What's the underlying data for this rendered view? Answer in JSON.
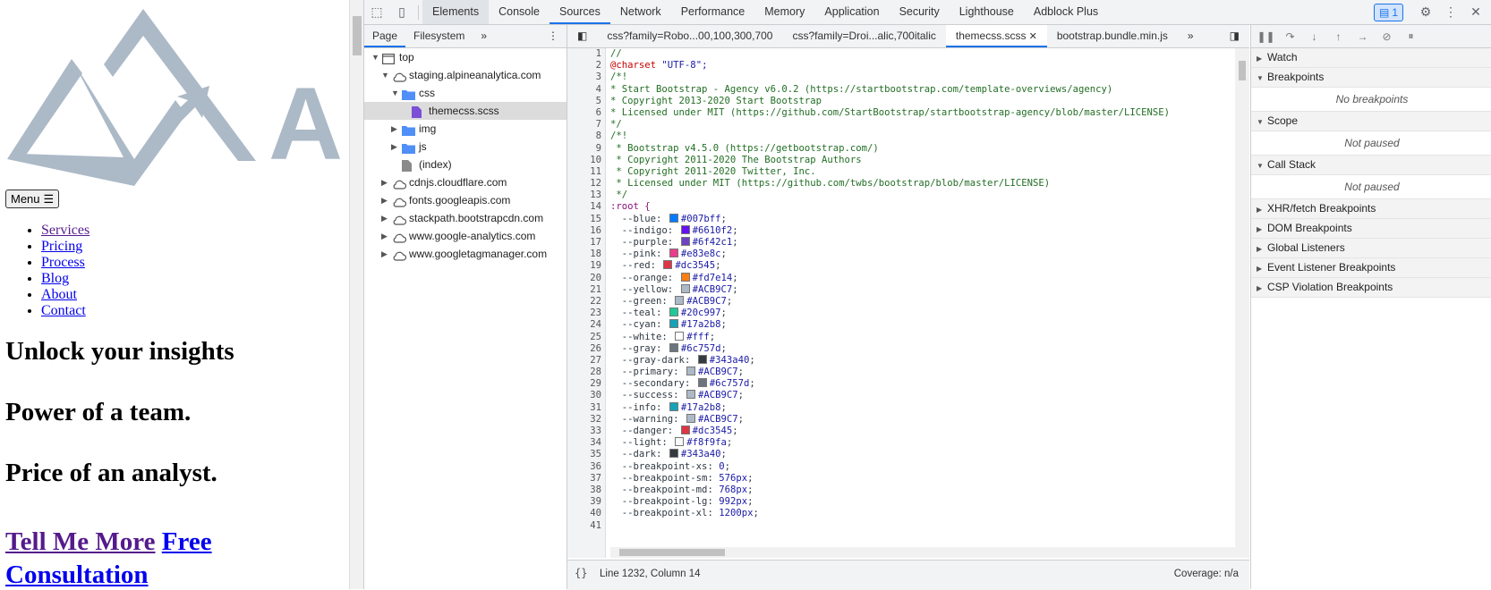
{
  "webpage": {
    "logo_letter": "A",
    "menu_label": "Menu",
    "nav": [
      "Services",
      "Pricing",
      "Process",
      "Blog",
      "About",
      "Contact"
    ],
    "headings": [
      "Unlock your insights",
      "Power of a team.",
      "Price of an analyst."
    ],
    "cta": {
      "tell_me_more": "Tell Me More",
      "free_consultation": "Free Consultation"
    }
  },
  "devtools": {
    "main_tabs": [
      "Elements",
      "Console",
      "Sources",
      "Network",
      "Performance",
      "Memory",
      "Application",
      "Security",
      "Lighthouse",
      "Adblock Plus"
    ],
    "issues_count": "1",
    "navigator": {
      "tabs": [
        "Page",
        "Filesystem"
      ],
      "tree": [
        {
          "label": "top",
          "level": 0,
          "type": "frame",
          "open": true
        },
        {
          "label": "staging.alpineanalytica.com",
          "level": 1,
          "type": "cloud",
          "open": true
        },
        {
          "label": "css",
          "level": 2,
          "type": "folder",
          "open": true
        },
        {
          "label": "themecss.scss",
          "level": 3,
          "type": "file-css",
          "selected": true
        },
        {
          "label": "img",
          "level": 2,
          "type": "folder",
          "open": false
        },
        {
          "label": "js",
          "level": 2,
          "type": "folder",
          "open": false
        },
        {
          "label": "(index)",
          "level": 2,
          "type": "file",
          "leaf": true
        },
        {
          "label": "cdnjs.cloudflare.com",
          "level": 1,
          "type": "cloud",
          "open": false
        },
        {
          "label": "fonts.googleapis.com",
          "level": 1,
          "type": "cloud",
          "open": false
        },
        {
          "label": "stackpath.bootstrapcdn.com",
          "level": 1,
          "type": "cloud",
          "open": false
        },
        {
          "label": "www.google-analytics.com",
          "level": 1,
          "type": "cloud",
          "open": false
        },
        {
          "label": "www.googletagmanager.com",
          "level": 1,
          "type": "cloud",
          "open": false
        }
      ]
    },
    "editor_tabs": [
      {
        "label": "css?family=Robo...00,100,300,700",
        "closable": false,
        "selected": false
      },
      {
        "label": "css?family=Droi...alic,700italic",
        "closable": false,
        "selected": false
      },
      {
        "label": "themecss.scss",
        "closable": true,
        "selected": true
      },
      {
        "label": "bootstrap.bundle.min.js",
        "closable": false,
        "selected": false
      }
    ],
    "code_lines": [
      {
        "t": "cm",
        "text": "//"
      },
      {
        "t": "charset",
        "at": "@charset",
        "val": "\"UTF-8\";"
      },
      {
        "t": "cm",
        "text": "/*!"
      },
      {
        "t": "cm",
        "text": "* Start Bootstrap - Agency v6.0.2 (https://startbootstrap.com/template-overviews/agency)"
      },
      {
        "t": "cm",
        "text": "* Copyright 2013-2020 Start Bootstrap"
      },
      {
        "t": "cm",
        "text": "* Licensed under MIT (https://github.com/StartBootstrap/startbootstrap-agency/blob/master/LICENSE)"
      },
      {
        "t": "cm",
        "text": "*/"
      },
      {
        "t": "cm",
        "text": "/*!"
      },
      {
        "t": "cm",
        "text": " * Bootstrap v4.5.0 (https://getbootstrap.com/)"
      },
      {
        "t": "cm",
        "text": " * Copyright 2011-2020 The Bootstrap Authors"
      },
      {
        "t": "cm",
        "text": " * Copyright 2011-2020 Twitter, Inc."
      },
      {
        "t": "cm",
        "text": " * Licensed under MIT (https://github.com/twbs/bootstrap/blob/master/LICENSE)"
      },
      {
        "t": "cm",
        "text": " */"
      },
      {
        "t": "sel",
        "text": ":root {"
      },
      {
        "t": "color",
        "prop": "--blue",
        "val": "#007bff",
        "swatch": "#007bff"
      },
      {
        "t": "color",
        "prop": "--indigo",
        "val": "#6610f2",
        "swatch": "#6610f2"
      },
      {
        "t": "color",
        "prop": "--purple",
        "val": "#6f42c1",
        "swatch": "#6f42c1"
      },
      {
        "t": "color",
        "prop": "--pink",
        "val": "#e83e8c",
        "swatch": "#e83e8c"
      },
      {
        "t": "color",
        "prop": "--red",
        "val": "#dc3545",
        "swatch": "#dc3545"
      },
      {
        "t": "color",
        "prop": "--orange",
        "val": "#fd7e14",
        "swatch": "#fd7e14"
      },
      {
        "t": "color",
        "prop": "--yellow",
        "val": "#ACB9C7",
        "swatch": "#ACB9C7"
      },
      {
        "t": "color",
        "prop": "--green",
        "val": "#ACB9C7",
        "swatch": "#ACB9C7"
      },
      {
        "t": "color",
        "prop": "--teal",
        "val": "#20c997",
        "swatch": "#20c997"
      },
      {
        "t": "color",
        "prop": "--cyan",
        "val": "#17a2b8",
        "swatch": "#17a2b8"
      },
      {
        "t": "color",
        "prop": "--white",
        "val": "#fff",
        "swatch": "#ffffff"
      },
      {
        "t": "color",
        "prop": "--gray",
        "val": "#6c757d",
        "swatch": "#6c757d"
      },
      {
        "t": "color",
        "prop": "--gray-dark",
        "val": "#343a40",
        "swatch": "#343a40"
      },
      {
        "t": "color",
        "prop": "--primary",
        "val": "#ACB9C7",
        "swatch": "#ACB9C7"
      },
      {
        "t": "color",
        "prop": "--secondary",
        "val": "#6c757d",
        "swatch": "#6c757d"
      },
      {
        "t": "color",
        "prop": "--success",
        "val": "#ACB9C7",
        "swatch": "#ACB9C7"
      },
      {
        "t": "color",
        "prop": "--info",
        "val": "#17a2b8",
        "swatch": "#17a2b8"
      },
      {
        "t": "color",
        "prop": "--warning",
        "val": "#ACB9C7",
        "swatch": "#ACB9C7"
      },
      {
        "t": "color",
        "prop": "--danger",
        "val": "#dc3545",
        "swatch": "#dc3545"
      },
      {
        "t": "color",
        "prop": "--light",
        "val": "#f8f9fa",
        "swatch": "#f8f9fa"
      },
      {
        "t": "color",
        "prop": "--dark",
        "val": "#343a40",
        "swatch": "#343a40"
      },
      {
        "t": "plain",
        "prop": "--breakpoint-xs",
        "val": "0"
      },
      {
        "t": "plain",
        "prop": "--breakpoint-sm",
        "val": "576px"
      },
      {
        "t": "plain",
        "prop": "--breakpoint-md",
        "val": "768px"
      },
      {
        "t": "plain",
        "prop": "--breakpoint-lg",
        "val": "992px"
      },
      {
        "t": "plain",
        "prop": "--breakpoint-xl",
        "val": "1200px"
      },
      {
        "t": "blank",
        "text": ""
      }
    ],
    "status": {
      "pretty_print": "{}",
      "cursor": "Line 1232, Column 14",
      "coverage": "Coverage: n/a"
    },
    "debugger": {
      "sections": [
        {
          "title": "Watch",
          "open": false
        },
        {
          "title": "Breakpoints",
          "open": true,
          "body": "No breakpoints"
        },
        {
          "title": "Scope",
          "open": true,
          "body": "Not paused"
        },
        {
          "title": "Call Stack",
          "open": true,
          "body": "Not paused"
        },
        {
          "title": "XHR/fetch Breakpoints",
          "open": false
        },
        {
          "title": "DOM Breakpoints",
          "open": false
        },
        {
          "title": "Global Listeners",
          "open": false
        },
        {
          "title": "Event Listener Breakpoints",
          "open": false
        },
        {
          "title": "CSP Violation Breakpoints",
          "open": false
        }
      ]
    },
    "colors": {
      "accent": "#1a73e8",
      "logo": "#ACB9C7"
    }
  }
}
